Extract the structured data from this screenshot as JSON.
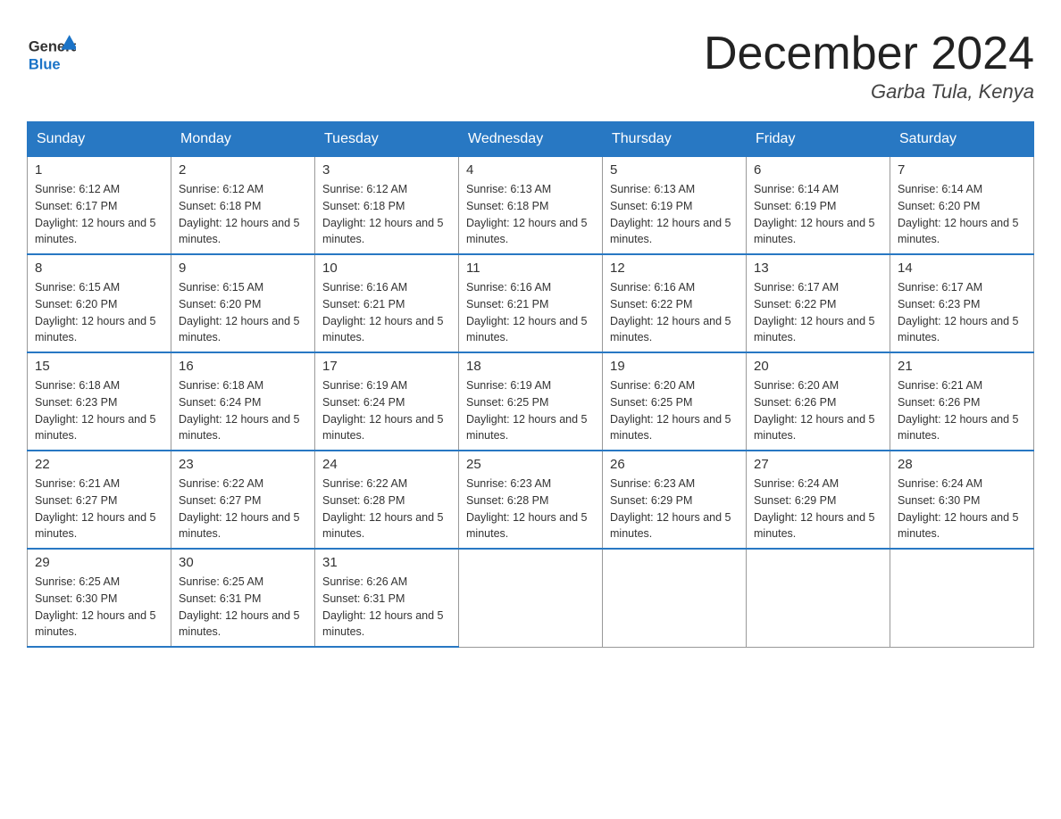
{
  "header": {
    "logo_general": "General",
    "logo_blue": "Blue",
    "month": "December 2024",
    "location": "Garba Tula, Kenya"
  },
  "weekdays": [
    "Sunday",
    "Monday",
    "Tuesday",
    "Wednesday",
    "Thursday",
    "Friday",
    "Saturday"
  ],
  "weeks": [
    [
      {
        "day": "1",
        "sunrise": "6:12 AM",
        "sunset": "6:17 PM",
        "daylight": "12 hours and 5 minutes."
      },
      {
        "day": "2",
        "sunrise": "6:12 AM",
        "sunset": "6:18 PM",
        "daylight": "12 hours and 5 minutes."
      },
      {
        "day": "3",
        "sunrise": "6:12 AM",
        "sunset": "6:18 PM",
        "daylight": "12 hours and 5 minutes."
      },
      {
        "day": "4",
        "sunrise": "6:13 AM",
        "sunset": "6:18 PM",
        "daylight": "12 hours and 5 minutes."
      },
      {
        "day": "5",
        "sunrise": "6:13 AM",
        "sunset": "6:19 PM",
        "daylight": "12 hours and 5 minutes."
      },
      {
        "day": "6",
        "sunrise": "6:14 AM",
        "sunset": "6:19 PM",
        "daylight": "12 hours and 5 minutes."
      },
      {
        "day": "7",
        "sunrise": "6:14 AM",
        "sunset": "6:20 PM",
        "daylight": "12 hours and 5 minutes."
      }
    ],
    [
      {
        "day": "8",
        "sunrise": "6:15 AM",
        "sunset": "6:20 PM",
        "daylight": "12 hours and 5 minutes."
      },
      {
        "day": "9",
        "sunrise": "6:15 AM",
        "sunset": "6:20 PM",
        "daylight": "12 hours and 5 minutes."
      },
      {
        "day": "10",
        "sunrise": "6:16 AM",
        "sunset": "6:21 PM",
        "daylight": "12 hours and 5 minutes."
      },
      {
        "day": "11",
        "sunrise": "6:16 AM",
        "sunset": "6:21 PM",
        "daylight": "12 hours and 5 minutes."
      },
      {
        "day": "12",
        "sunrise": "6:16 AM",
        "sunset": "6:22 PM",
        "daylight": "12 hours and 5 minutes."
      },
      {
        "day": "13",
        "sunrise": "6:17 AM",
        "sunset": "6:22 PM",
        "daylight": "12 hours and 5 minutes."
      },
      {
        "day": "14",
        "sunrise": "6:17 AM",
        "sunset": "6:23 PM",
        "daylight": "12 hours and 5 minutes."
      }
    ],
    [
      {
        "day": "15",
        "sunrise": "6:18 AM",
        "sunset": "6:23 PM",
        "daylight": "12 hours and 5 minutes."
      },
      {
        "day": "16",
        "sunrise": "6:18 AM",
        "sunset": "6:24 PM",
        "daylight": "12 hours and 5 minutes."
      },
      {
        "day": "17",
        "sunrise": "6:19 AM",
        "sunset": "6:24 PM",
        "daylight": "12 hours and 5 minutes."
      },
      {
        "day": "18",
        "sunrise": "6:19 AM",
        "sunset": "6:25 PM",
        "daylight": "12 hours and 5 minutes."
      },
      {
        "day": "19",
        "sunrise": "6:20 AM",
        "sunset": "6:25 PM",
        "daylight": "12 hours and 5 minutes."
      },
      {
        "day": "20",
        "sunrise": "6:20 AM",
        "sunset": "6:26 PM",
        "daylight": "12 hours and 5 minutes."
      },
      {
        "day": "21",
        "sunrise": "6:21 AM",
        "sunset": "6:26 PM",
        "daylight": "12 hours and 5 minutes."
      }
    ],
    [
      {
        "day": "22",
        "sunrise": "6:21 AM",
        "sunset": "6:27 PM",
        "daylight": "12 hours and 5 minutes."
      },
      {
        "day": "23",
        "sunrise": "6:22 AM",
        "sunset": "6:27 PM",
        "daylight": "12 hours and 5 minutes."
      },
      {
        "day": "24",
        "sunrise": "6:22 AM",
        "sunset": "6:28 PM",
        "daylight": "12 hours and 5 minutes."
      },
      {
        "day": "25",
        "sunrise": "6:23 AM",
        "sunset": "6:28 PM",
        "daylight": "12 hours and 5 minutes."
      },
      {
        "day": "26",
        "sunrise": "6:23 AM",
        "sunset": "6:29 PM",
        "daylight": "12 hours and 5 minutes."
      },
      {
        "day": "27",
        "sunrise": "6:24 AM",
        "sunset": "6:29 PM",
        "daylight": "12 hours and 5 minutes."
      },
      {
        "day": "28",
        "sunrise": "6:24 AM",
        "sunset": "6:30 PM",
        "daylight": "12 hours and 5 minutes."
      }
    ],
    [
      {
        "day": "29",
        "sunrise": "6:25 AM",
        "sunset": "6:30 PM",
        "daylight": "12 hours and 5 minutes."
      },
      {
        "day": "30",
        "sunrise": "6:25 AM",
        "sunset": "6:31 PM",
        "daylight": "12 hours and 5 minutes."
      },
      {
        "day": "31",
        "sunrise": "6:26 AM",
        "sunset": "6:31 PM",
        "daylight": "12 hours and 5 minutes."
      },
      null,
      null,
      null,
      null
    ]
  ]
}
